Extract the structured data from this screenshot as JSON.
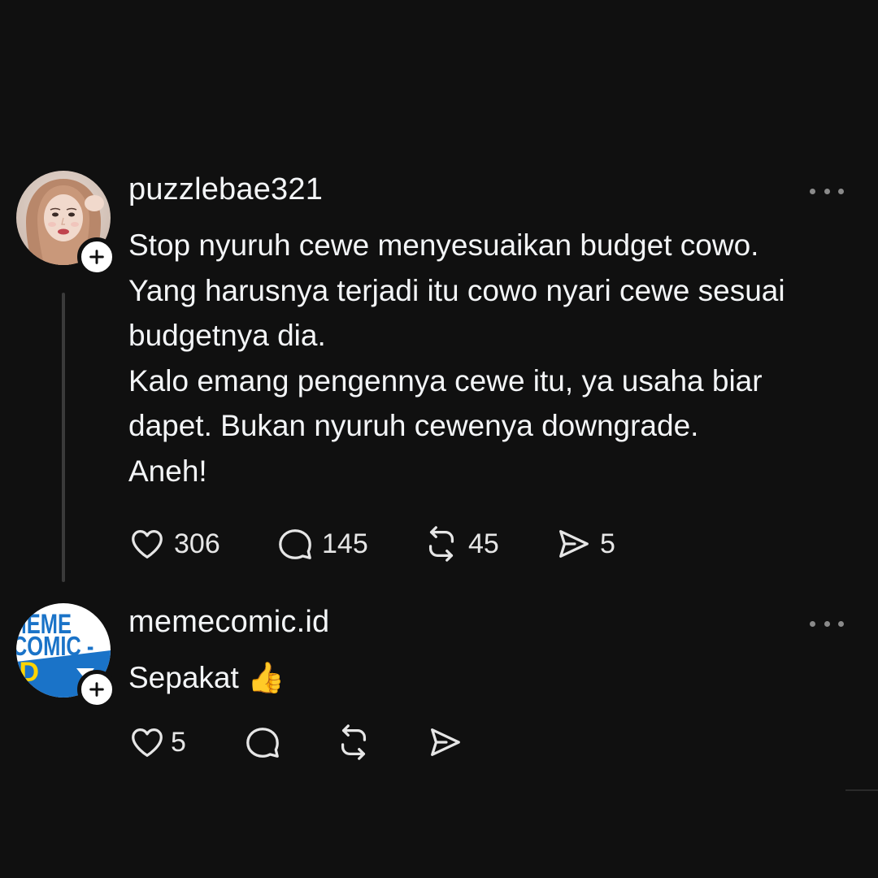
{
  "posts": [
    {
      "username": "puzzlebae321",
      "avatar": "user-photo-avatar",
      "text_lines": [
        "Stop nyuruh cewe menyesuaikan budget cowo.",
        "Yang harusnya terjadi itu cowo nyari cewe sesuai",
        "budgetnya dia.",
        "Kalo emang pengennya cewe itu, ya usaha biar",
        "dapet. Bukan nyuruh cewenya downgrade.",
        "Aneh!"
      ],
      "likes": "306",
      "replies": "145",
      "reposts": "45",
      "shares": "5"
    },
    {
      "username": "memecomic.id",
      "avatar": "memecomic-logo-avatar",
      "avatar_logo_text": [
        "MEME",
        "COMIC -",
        "ID"
      ],
      "text_lines": [
        "Sepakat 👍"
      ],
      "likes": "5"
    }
  ],
  "icons": {
    "like": "heart-icon",
    "reply": "speech-bubble-icon",
    "repost": "repost-icon",
    "share": "send-icon",
    "more": "more-horizontal-icon",
    "follow": "plus-icon"
  },
  "colors": {
    "background": "#101010",
    "text": "#f3f5f7",
    "muted": "#8a8a8a",
    "thread_line": "#3a3a3a",
    "memecomic_blue": "#1a73c8"
  }
}
